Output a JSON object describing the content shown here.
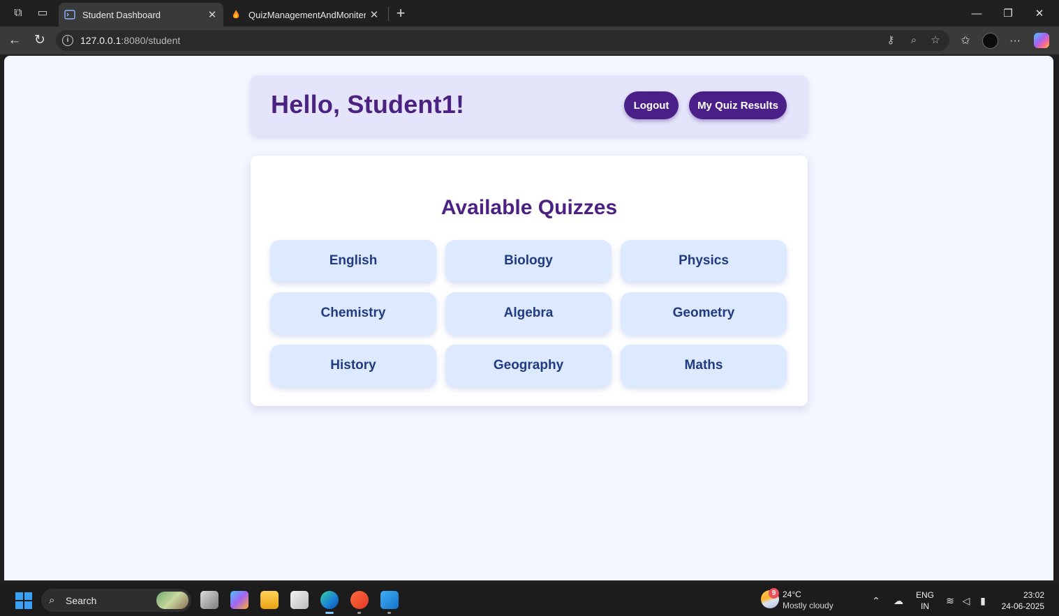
{
  "browser": {
    "tabs": [
      {
        "title": "Student Dashboard",
        "active": true
      },
      {
        "title": "QuizManagementAndMonitering",
        "active": false
      }
    ],
    "new_tab_glyph": "+",
    "address": {
      "host": "127.0.0.1",
      "rest": ":8080/student"
    }
  },
  "header": {
    "greeting": "Hello, Student1!",
    "logout_label": "Logout",
    "results_label": "My Quiz Results"
  },
  "quizzes": {
    "heading": "Available Quizzes",
    "items": [
      "English",
      "Biology",
      "Physics",
      "Chemistry",
      "Algebra",
      "Geometry",
      "History",
      "Geography",
      "Maths"
    ]
  },
  "taskbar": {
    "search_label": "Search",
    "weather": {
      "badge": "9",
      "temp": "24°C",
      "desc": "Mostly cloudy"
    },
    "lang": {
      "top": "ENG",
      "bottom": "IN"
    },
    "clock": {
      "time": "23:02",
      "date": "24-06-2025"
    }
  },
  "colors": {
    "accent": "#4a1f88",
    "heading": "#4b2182",
    "quiz_button_bg": "#dce9ff",
    "quiz_button_text": "#223a80",
    "page_bg": "#f3f7ff",
    "header_card_bg": "#e4e5fb"
  }
}
